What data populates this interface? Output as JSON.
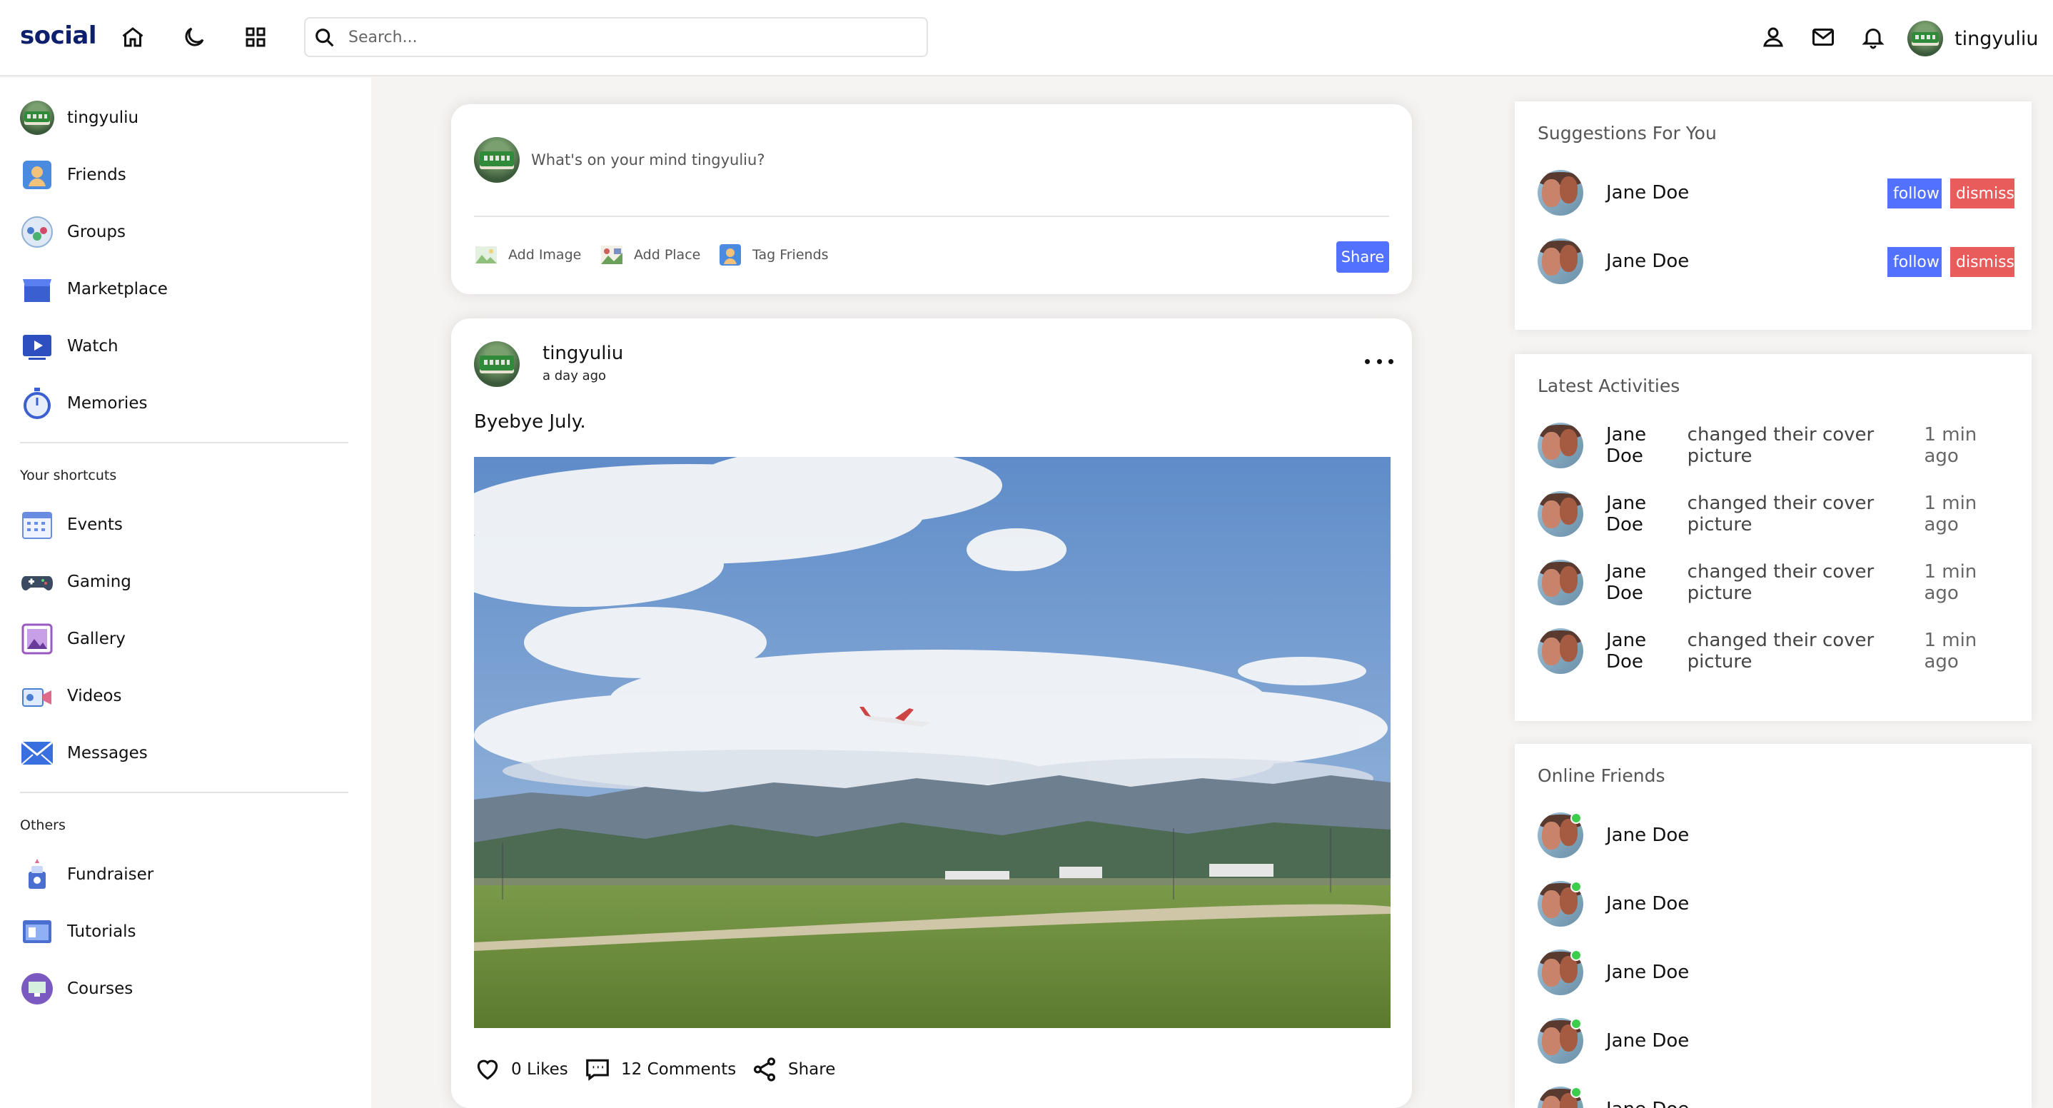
{
  "navbar": {
    "logo": "social",
    "search_placeholder": "Search...",
    "username": "tingyuliu"
  },
  "sidebar": {
    "user": "tingyuliu",
    "main_items": [
      {
        "label": "Friends",
        "icon": "friends-icon"
      },
      {
        "label": "Groups",
        "icon": "groups-icon"
      },
      {
        "label": "Marketplace",
        "icon": "marketplace-icon"
      },
      {
        "label": "Watch",
        "icon": "watch-icon"
      },
      {
        "label": "Memories",
        "icon": "memories-icon"
      }
    ],
    "shortcuts_title": "Your shortcuts",
    "shortcuts": [
      {
        "label": "Events",
        "icon": "events-icon"
      },
      {
        "label": "Gaming",
        "icon": "gaming-icon"
      },
      {
        "label": "Gallery",
        "icon": "gallery-icon"
      },
      {
        "label": "Videos",
        "icon": "videos-icon"
      },
      {
        "label": "Messages",
        "icon": "messages-icon"
      }
    ],
    "others_title": "Others",
    "others": [
      {
        "label": "Fundraiser",
        "icon": "fundraiser-icon"
      },
      {
        "label": "Tutorials",
        "icon": "tutorials-icon"
      },
      {
        "label": "Courses",
        "icon": "courses-icon"
      }
    ]
  },
  "composer": {
    "prompt": "What's on your mind tingyuliu?",
    "add_image": "Add Image",
    "add_place": "Add Place",
    "tag_friends": "Tag Friends",
    "share": "Share"
  },
  "post": {
    "author": "tingyuliu",
    "time": "a day ago",
    "text": "Byebye July.",
    "likes": "0 Likes",
    "comments": "12 Comments",
    "share": "Share"
  },
  "suggestions": {
    "title": "Suggestions For You",
    "items": [
      {
        "name": "Jane Doe",
        "follow": "follow",
        "dismiss": "dismiss"
      },
      {
        "name": "Jane Doe",
        "follow": "follow",
        "dismiss": "dismiss"
      }
    ]
  },
  "activities": {
    "title": "Latest Activities",
    "items": [
      {
        "name": "Jane Doe",
        "action": "changed their cover picture",
        "time": "1 min ago"
      },
      {
        "name": "Jane Doe",
        "action": "changed their cover picture",
        "time": "1 min ago"
      },
      {
        "name": "Jane Doe",
        "action": "changed their cover picture",
        "time": "1 min ago"
      },
      {
        "name": "Jane Doe",
        "action": "changed their cover picture",
        "time": "1 min ago"
      }
    ]
  },
  "online": {
    "title": "Online Friends",
    "items": [
      {
        "name": "Jane Doe"
      },
      {
        "name": "Jane Doe"
      },
      {
        "name": "Jane Doe"
      },
      {
        "name": "Jane Doe"
      },
      {
        "name": "Jane Doe"
      }
    ]
  },
  "colors": {
    "accent": "#5271ff",
    "danger": "#e85c5c",
    "logo": "#0e1f6b",
    "online": "#3ccd4c"
  }
}
